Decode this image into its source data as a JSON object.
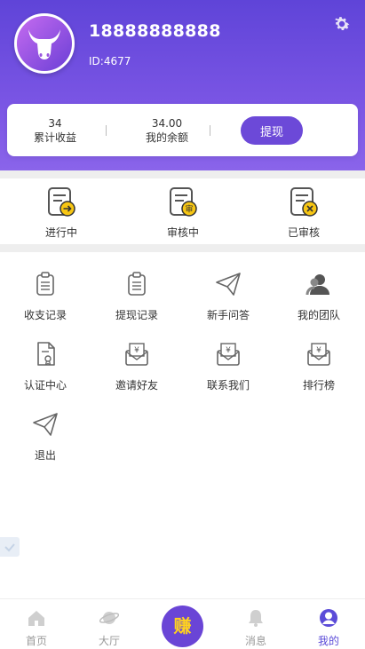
{
  "profile": {
    "phone": "18888888888",
    "id_text": "ID:4677"
  },
  "stats": {
    "total_earnings_value": "34",
    "total_earnings_label": "累计收益",
    "balance_value": "34.00",
    "balance_label": "我的余额",
    "withdraw_button": "提现"
  },
  "status_tabs": [
    {
      "label": "进行中",
      "icon": "in-progress-icon"
    },
    {
      "label": "审核中",
      "icon": "under-review-icon"
    },
    {
      "label": "已审核",
      "icon": "reviewed-icon"
    }
  ],
  "menu": [
    {
      "label": "收支记录",
      "icon": "clipboard-icon"
    },
    {
      "label": "提现记录",
      "icon": "clipboard-icon"
    },
    {
      "label": "新手问答",
      "icon": "paper-plane-icon"
    },
    {
      "label": "我的团队",
      "icon": "team-icon"
    },
    {
      "label": "认证中心",
      "icon": "certificate-icon"
    },
    {
      "label": "邀请好友",
      "icon": "yen-envelope-icon"
    },
    {
      "label": "联系我们",
      "icon": "yen-envelope-icon"
    },
    {
      "label": "排行榜",
      "icon": "yen-envelope-icon"
    },
    {
      "label": "退出",
      "icon": "paper-plane-icon"
    }
  ],
  "tabbar": {
    "home": "首页",
    "hall": "大厅",
    "earn": "赚",
    "messages": "消息",
    "mine": "我的"
  },
  "colors": {
    "brand_purple": "#6c49d8",
    "accent_yellow": "#ffd21e",
    "active_tab": "#5b4bd8"
  }
}
